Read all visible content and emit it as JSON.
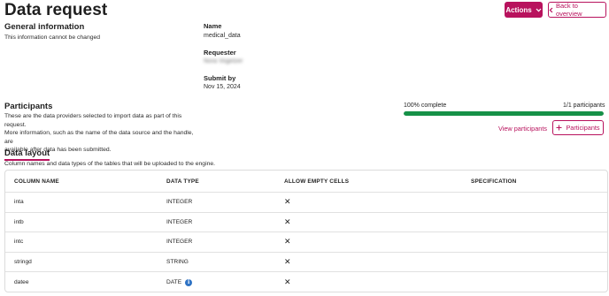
{
  "page": {
    "title": "Data request"
  },
  "header": {
    "actions_label": "Actions",
    "back_label": "Back to overview"
  },
  "general": {
    "title": "General information",
    "subtitle": "This information cannot be changed",
    "name_label": "Name",
    "name_value": "medical_data",
    "requester_label": "Requester",
    "requester_value": "Nora Vogelzer",
    "submit_label": "Submit by",
    "submit_value": "Nov 15, 2024"
  },
  "participants": {
    "title": "Participants",
    "description_line1": "These are the data providers selected to import data as part of this request.",
    "description_line2": "More information, such as the name of the data source and the handle, are",
    "description_line3": "available after data has been submitted.",
    "progress_label": "100% complete",
    "progress_percent": 100,
    "count_label": "1/1 participants",
    "view_link": "View participants",
    "add_button": "Participants"
  },
  "layout": {
    "title": "Data layout",
    "subtitle": "Column names and data types of the tables that will be uploaded to the engine.",
    "columns": [
      "COLUMN NAME",
      "DATA TYPE",
      "ALLOW EMPTY CELLS",
      "SPECIFICATION"
    ],
    "rows": [
      {
        "name": "inta",
        "type": "INTEGER",
        "empty": "✕",
        "spec": ""
      },
      {
        "name": "intb",
        "type": "INTEGER",
        "empty": "✕",
        "spec": ""
      },
      {
        "name": "intc",
        "type": "INTEGER",
        "empty": "✕",
        "spec": ""
      },
      {
        "name": "stringd",
        "type": "STRING",
        "empty": "✕",
        "spec": ""
      },
      {
        "name": "datee",
        "type": "DATE",
        "empty": "✕",
        "spec": ""
      }
    ]
  },
  "colors": {
    "accent": "#b8125d",
    "progress": "#169147",
    "info": "#2f73c4"
  },
  "icons": {
    "actions": "chevron-down-icon",
    "back": "chevron-left-icon",
    "add": "plus-icon",
    "date_info": "info-icon"
  }
}
